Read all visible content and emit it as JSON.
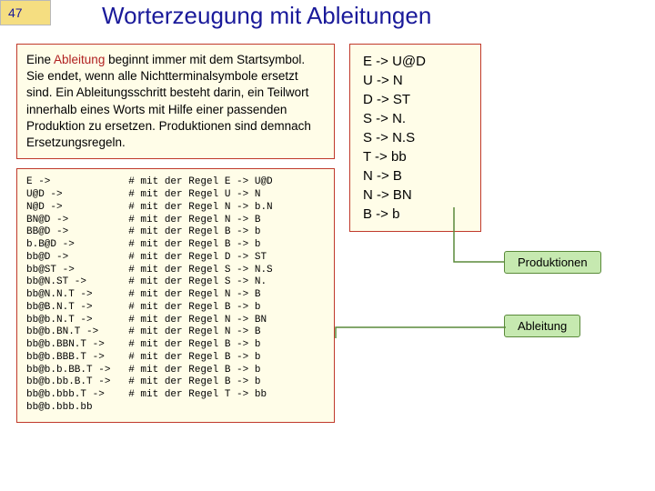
{
  "page_number": "47",
  "title": "Worterzeugung mit Ableitungen",
  "intro_prefix": "Eine ",
  "intro_highlight": "Ableitung",
  "intro_rest": " beginnt immer mit dem Startsymbol. Sie endet, wenn alle Nichtterminalsymbole ersetzt sind. Ein Ableitungsschritt besteht darin, ein Teilwort innerhalb eines Worts mit Hilfe einer passenden Produktion zu ersetzen. Produktionen sind demnach Ersetzungsregeln.",
  "derivation": "E ->             # mit der Regel E -> U@D\nU@D ->           # mit der Regel U -> N\nN@D ->           # mit der Regel N -> b.N\nBN@D ->          # mit der Regel N -> B\nBB@D ->          # mit der Regel B -> b\nb.B@D ->         # mit der Regel B -> b\nbb@D ->          # mit der Regel D -> ST\nbb@ST ->         # mit der Regel S -> N.S\nbb@N.ST ->       # mit der Regel S -> N.\nbb@N.N.T ->      # mit der Regel N -> B\nbb@B.N.T ->      # mit der Regel B -> b\nbb@b.N.T ->      # mit der Regel N -> BN\nbb@b.BN.T ->     # mit der Regel N -> B\nbb@b.BBN.T ->    # mit der Regel B -> b\nbb@b.BBB.T ->    # mit der Regel B -> b\nbb@b.b.BB.T ->   # mit der Regel B -> b\nbb@b.bb.B.T ->   # mit der Regel B -> b\nbb@b.bbb.T ->    # mit der Regel T -> bb\nbb@b.bbb.bb",
  "grammar": "E -> U@D\nU -> N\nD -> ST\nS -> N.\nS -> N.S\nT -> bb\nN -> B\nN -> BN\nB -> b",
  "callout_prod": "Produktionen",
  "callout_abl": "Ableitung"
}
